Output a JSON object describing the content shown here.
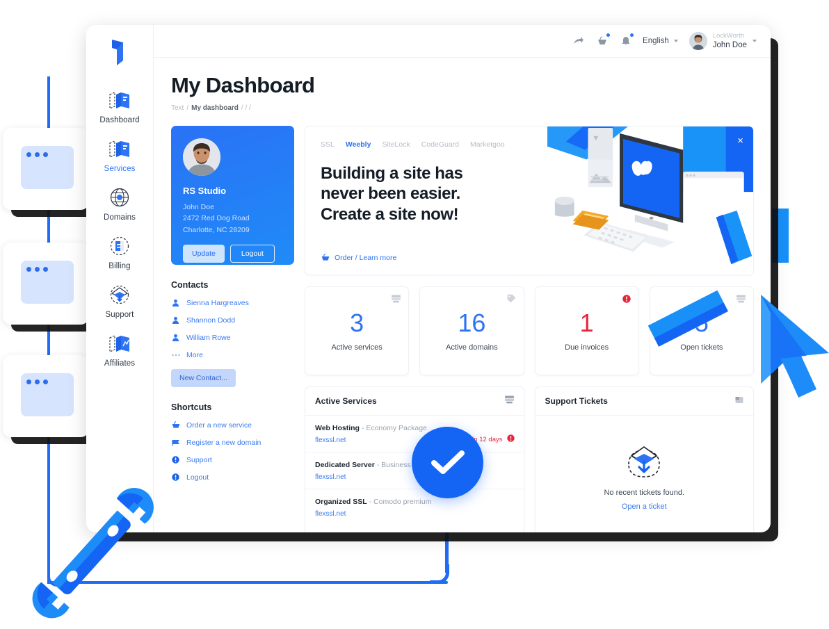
{
  "brand": {
    "logo_name": "bookmark-logo"
  },
  "sidebar": {
    "items": [
      {
        "label": "Dashboard",
        "icon": "dashboard-icon",
        "active": false
      },
      {
        "label": "Services",
        "icon": "services-icon",
        "active": true
      },
      {
        "label": "Domains",
        "icon": "globe-icon",
        "active": false
      },
      {
        "label": "Billing",
        "icon": "billing-icon",
        "active": false
      },
      {
        "label": "Support",
        "icon": "support-icon",
        "active": false
      },
      {
        "label": "Affiliates",
        "icon": "affiliates-icon",
        "active": false
      }
    ]
  },
  "topbar": {
    "share_icon": "share-arrow-icon",
    "cart_icon": "cart-icon",
    "bell_icon": "bell-icon",
    "language": "English",
    "user_company": "LockWorth",
    "user_name": "John Doe"
  },
  "page": {
    "title": "My Dashboard",
    "breadcrumb": [
      "Text",
      "/",
      "My dashboard",
      "/",
      "/",
      "/"
    ],
    "breadcrumb_root": "Text",
    "breadcrumb_current": "My dashboard",
    "breadcrumb_tail": "/  /  /"
  },
  "profile": {
    "company": "RS Studio",
    "person": "John Doe",
    "address1": "2472 Red Dog Road",
    "address2": "Charlotte, NC 28209",
    "update_label": "Update",
    "logout_label": "Logout"
  },
  "contacts": {
    "title": "Contacts",
    "items": [
      {
        "label": "Sienna Hargreaves",
        "icon": "user-icon"
      },
      {
        "label": "Shannon Dodd",
        "icon": "user-icon"
      },
      {
        "label": "William Rowe",
        "icon": "user-icon"
      },
      {
        "label": "More",
        "icon": "ellipsis-icon"
      }
    ],
    "new_contact_label": "New Contact..."
  },
  "shortcuts": {
    "title": "Shortcuts",
    "items": [
      {
        "label": "Order a new service",
        "icon": "cart-icon"
      },
      {
        "label": "Register a new domain",
        "icon": "flag-icon"
      },
      {
        "label": "Support",
        "icon": "alert-icon"
      },
      {
        "label": "Logout",
        "icon": "alert-icon"
      }
    ]
  },
  "promo": {
    "tabs": [
      {
        "label": "SSL",
        "active": false
      },
      {
        "label": "Weebly",
        "active": true
      },
      {
        "label": "SiteLock",
        "active": false
      },
      {
        "label": "CodeGuard",
        "active": false
      },
      {
        "label": "Marketgoo",
        "active": false
      }
    ],
    "headline_line1": "Building a site has",
    "headline_line2": "never been easier.",
    "headline_line3": "Create a site now!",
    "cta": "Order / Learn more",
    "cta_icon": "cart-icon",
    "close_icon": "close-icon",
    "illustration": "isometric-desktop-weebly-illustration"
  },
  "stats": [
    {
      "value": "3",
      "label": "Active services",
      "icon": "server-icon",
      "danger": false
    },
    {
      "value": "16",
      "label": "Active domains",
      "icon": "tag-icon",
      "danger": false
    },
    {
      "value": "1",
      "label": "Due invoices",
      "icon": "alert-icon",
      "danger": true
    },
    {
      "value": "5",
      "label": "Open tickets",
      "icon": "server-icon",
      "danger": false
    }
  ],
  "active_services": {
    "title": "Active Services",
    "header_icon": "server-icon",
    "rows": [
      {
        "name": "Web Hosting",
        "plan": "- Economy Package",
        "domain": "flexssl.net",
        "warning": "Expire in 12 days",
        "warning_icon": "alert-icon"
      },
      {
        "name": "Dedicated Server",
        "plan": "- Business",
        "domain": "flexssl.net",
        "warning": "",
        "warning_icon": ""
      },
      {
        "name": "Organized SSL",
        "plan": "- Comodo premium",
        "domain": "flexssl.net",
        "warning": "",
        "warning_icon": ""
      }
    ]
  },
  "support_tickets": {
    "title": "Support Tickets",
    "header_icon": "inbox-icon",
    "empty_icon": "empty-inbox-icon",
    "empty_text": "No recent tickets found.",
    "empty_link": "Open a ticket"
  },
  "decorations": {
    "check_badge_icon": "check-circle-icon",
    "wrench_icon": "wrench-icon",
    "cursor_icon": "cursor-arrow-icon",
    "mini_cards": [
      {
        "dots": 3
      },
      {
        "dots": 3
      },
      {
        "dots": 3
      }
    ]
  },
  "colors": {
    "accent": "#2d74f5",
    "accent_deep": "#1565f5",
    "danger": "#e8243c",
    "ink": "#141c26",
    "muted": "#b4bbc4",
    "panel_border": "#eef1f5"
  }
}
